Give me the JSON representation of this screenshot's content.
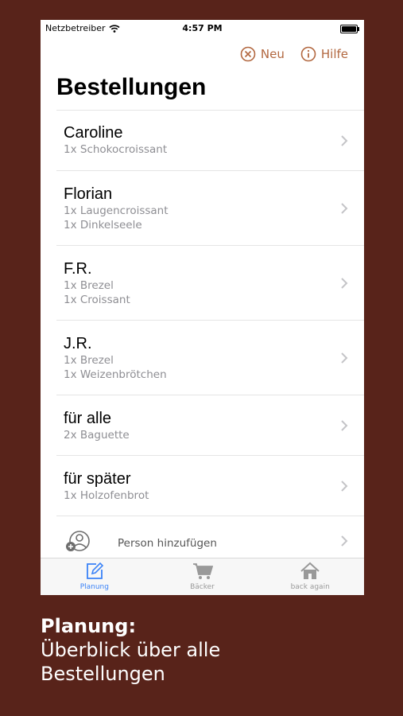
{
  "status_bar": {
    "carrier": "Netzbetreiber",
    "time": "4:57 PM"
  },
  "nav": {
    "new_label": "Neu",
    "help_label": "Hilfe"
  },
  "title": "Bestellungen",
  "orders": [
    {
      "name": "Caroline",
      "items": [
        "1x Schokocroissant"
      ]
    },
    {
      "name": "Florian",
      "items": [
        "1x Laugencroissant",
        "1x Dinkelseele"
      ]
    },
    {
      "name": "F.R.",
      "items": [
        "1x Brezel",
        "1x Croissant"
      ]
    },
    {
      "name": "J.R.",
      "items": [
        "1x Brezel",
        "1x Weizenbrötchen"
      ]
    },
    {
      "name": "für alle",
      "items": [
        "2x Baguette"
      ]
    },
    {
      "name": "für später",
      "items": [
        "1x Holzofenbrot"
      ]
    }
  ],
  "add_person": "Person hinzufügen",
  "tabs": [
    {
      "label": "Planung",
      "icon": "edit-icon",
      "active": true
    },
    {
      "label": "Bäcker",
      "icon": "cart-icon",
      "active": false
    },
    {
      "label": "back again",
      "icon": "home-icon",
      "active": false
    }
  ],
  "caption": {
    "title": "Planung:",
    "line1": "Überblick über alle",
    "line2": "Bestellungen"
  },
  "colors": {
    "background": "#58231a",
    "accent": "#b2673f",
    "tab_active": "#3a82f7"
  }
}
